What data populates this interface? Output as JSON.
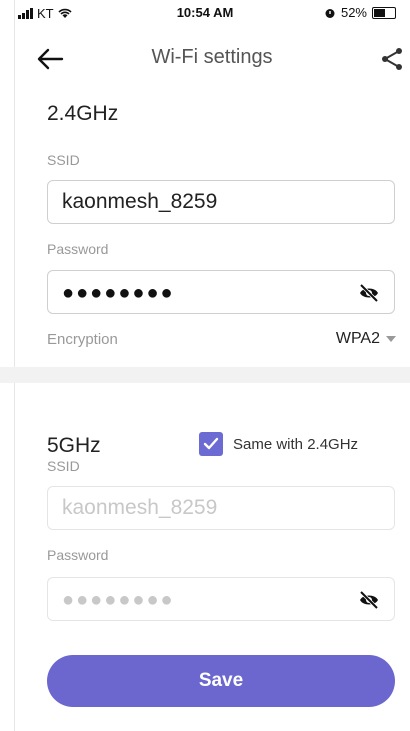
{
  "status_bar": {
    "carrier": "KT",
    "time": "10:54 AM",
    "battery": "52%"
  },
  "header": {
    "title": "Wi-Fi settings"
  },
  "band_24": {
    "title": "2.4GHz",
    "ssid_label": "SSID",
    "ssid_value": "kaonmesh_8259",
    "password_label": "Password",
    "password_masked": "●●●●●●●●",
    "encryption_label": "Encryption",
    "encryption_value": "WPA2"
  },
  "band_5": {
    "title": "5GHz",
    "same_label": "Same with 2.4GHz",
    "same_checked": true,
    "ssid_label": "SSID",
    "ssid_value": "kaonmesh_8259",
    "password_label": "Password",
    "password_masked": "●●●●●●●●"
  },
  "save_label": "Save",
  "colors": {
    "accent": "#6b67cf",
    "checkbox": "#6b6bd3"
  }
}
